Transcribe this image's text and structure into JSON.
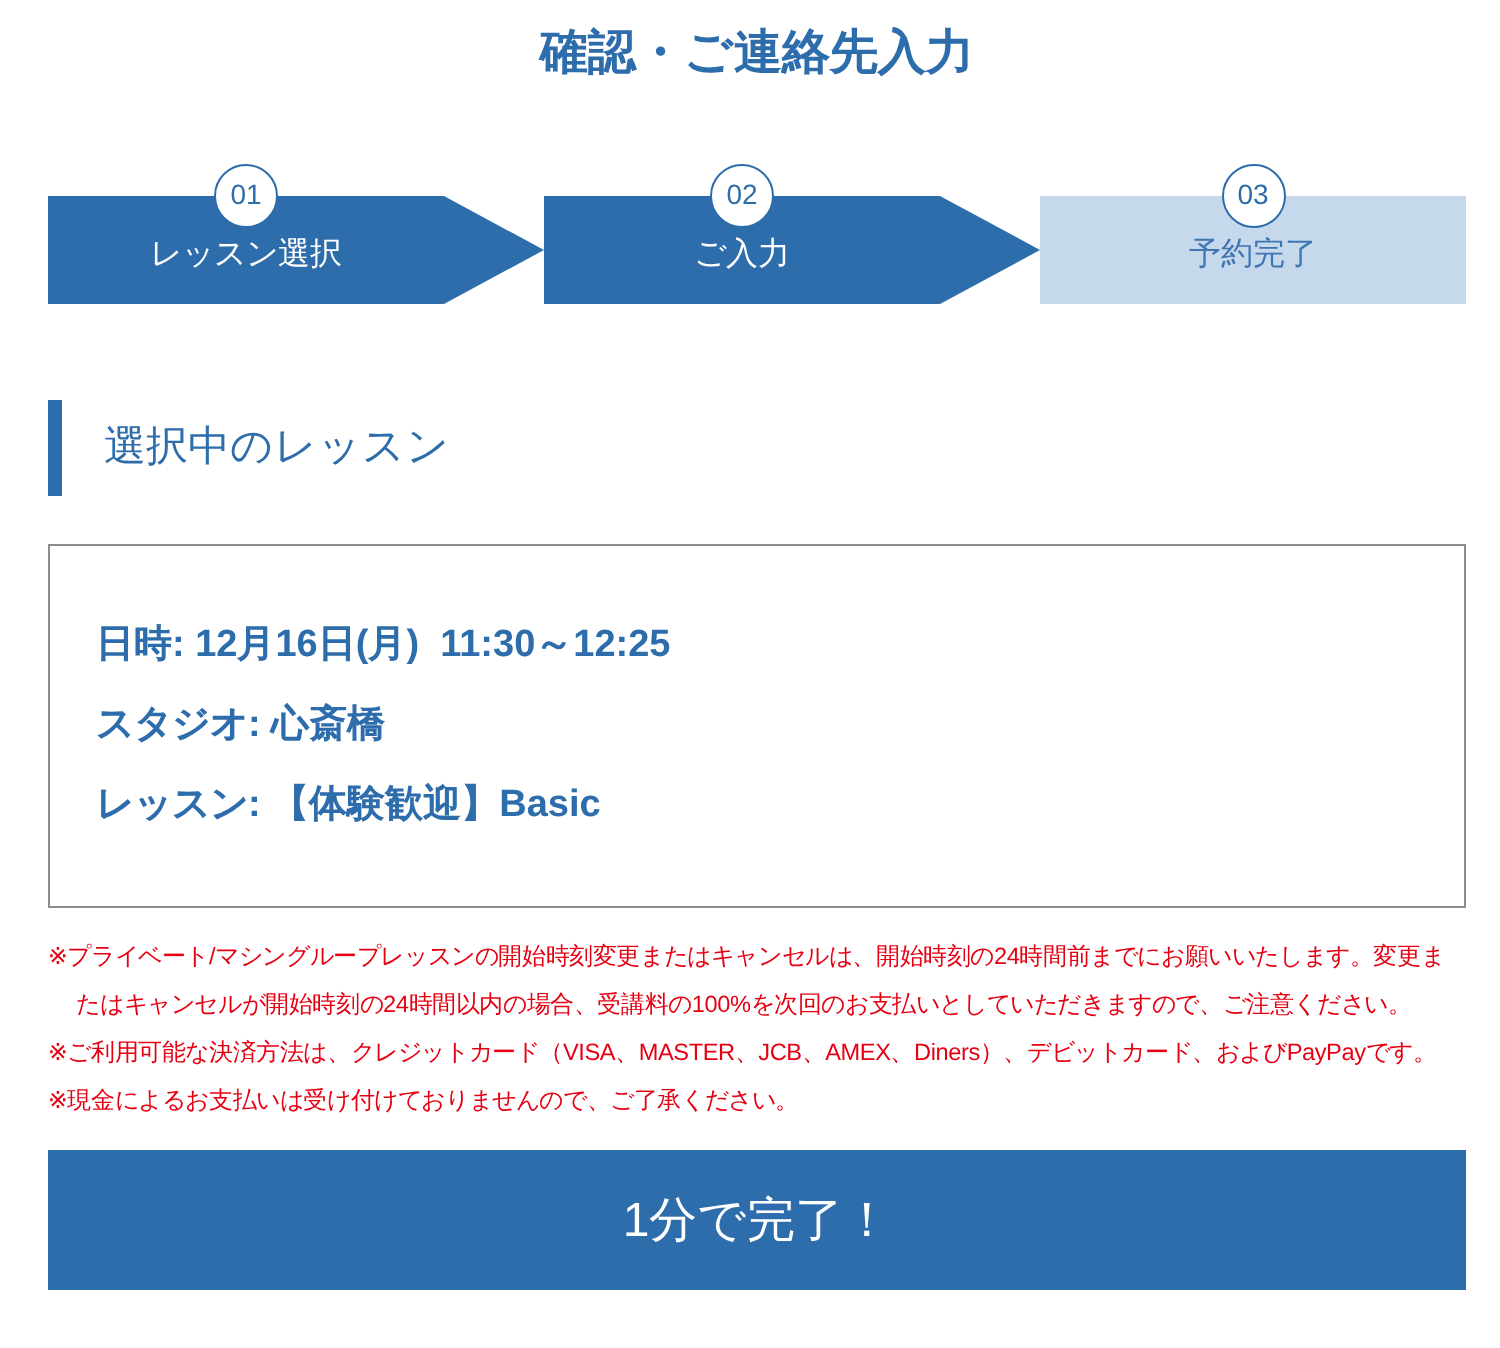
{
  "page": {
    "title": "確認・ご連絡先入力"
  },
  "steps": [
    {
      "number": "01",
      "label": "レッスン選択",
      "done": true
    },
    {
      "number": "02",
      "label": "ご入力",
      "done": true
    },
    {
      "number": "03",
      "label": "予約完了",
      "done": false
    }
  ],
  "section": {
    "heading": "選択中のレッスン"
  },
  "lesson_details": [
    "日時: 12月16日(月)  11:30～12:25",
    "スタジオ: 心斎橋",
    "レッスン: 【体験歓迎】Basic"
  ],
  "notes": [
    "※プライベート/マシングループレッスンの開始時刻変更またはキャンセルは、開始時刻の24時間前までにお願いいたします。変更またはキャンセルが開始時刻の24時間以内の場合、受講料の100%を次回のお支払いとしていただきますので、ご注意ください。",
    "※ご利用可能な決済方法は、クレジットカード（VISA、MASTER、JCB、AMEX、Diners）、デビットカード、およびPayPayです。",
    "※現金によるお支払いは受け付けておりませんので、ご了承ください。"
  ],
  "submit_button": {
    "label": "1分で完了！"
  }
}
